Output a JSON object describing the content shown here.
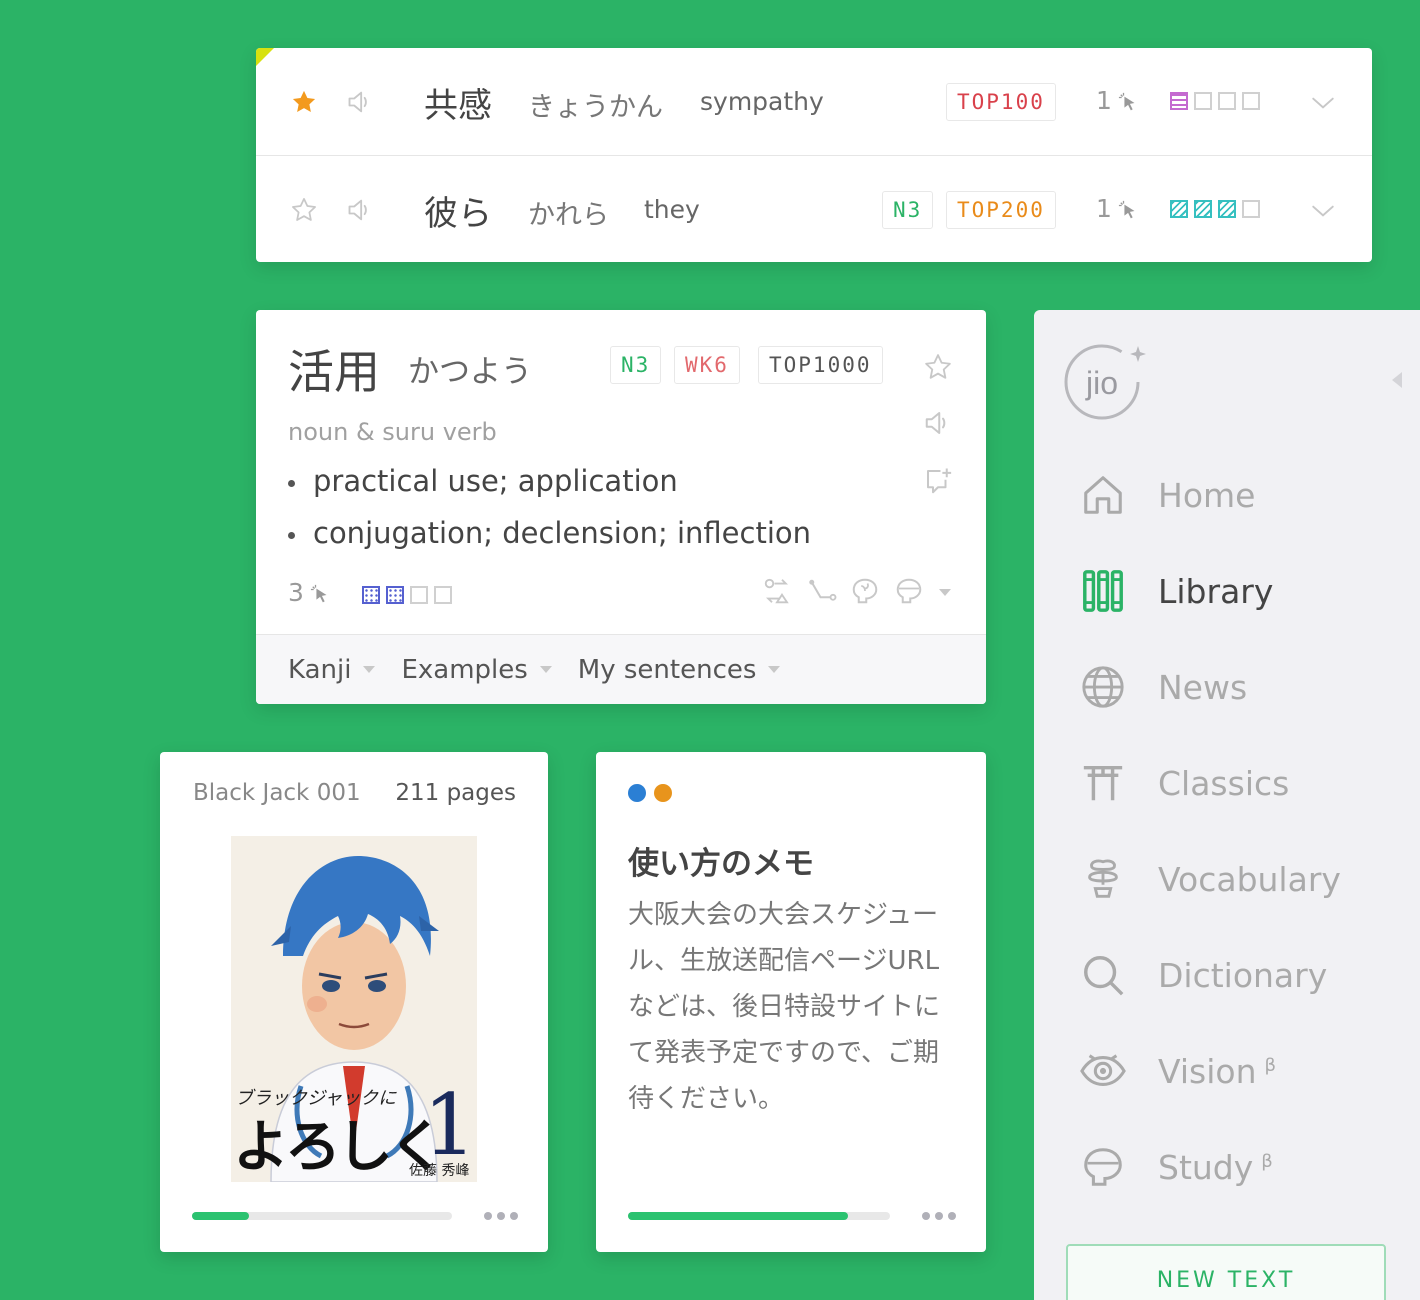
{
  "wordlist": {
    "rows": [
      {
        "starred": true,
        "kanji": "共感",
        "kana": "きょうかん",
        "meaning": "sympathy",
        "tags": [
          "TOP100"
        ],
        "count": "1"
      },
      {
        "starred": false,
        "kanji": "彼ら",
        "kana": "かれら",
        "meaning": "they",
        "tags": [
          "N3",
          "TOP200"
        ],
        "count": "1"
      }
    ]
  },
  "definition": {
    "kanji": "活用",
    "kana": "かつよう",
    "tags": [
      "N3",
      "WK6",
      "TOP1000"
    ],
    "part_of_speech": "noun & suru verb",
    "senses": [
      "practical use; application",
      "conjugation; declension; inflection"
    ],
    "count": "3",
    "footer_tabs": [
      "Kanji",
      "Examples",
      "My sentences"
    ]
  },
  "book": {
    "title": "Black Jack 001",
    "pages": "211 pages",
    "cover_title_small": "ブラックジャックに",
    "cover_title_big": "よろしく",
    "cover_number": "1",
    "cover_author": "佐藤 秀峰",
    "progress": 0.22
  },
  "memo": {
    "title": "使い方のメモ",
    "body": "大阪大会の大会スケジュール、生放送配信ページURLなどは、後日特設サイトにて発表予定ですので、ご期待ください。",
    "dot_colors": [
      "#2b7fd4",
      "#e8941c"
    ],
    "progress": 0.84
  },
  "sidebar": {
    "logo_text": "jio",
    "items": [
      {
        "label": "Home",
        "icon": "home-icon",
        "active": false,
        "beta": ""
      },
      {
        "label": "Library",
        "icon": "library-icon",
        "active": true,
        "beta": ""
      },
      {
        "label": "News",
        "icon": "globe-icon",
        "active": false,
        "beta": ""
      },
      {
        "label": "Classics",
        "icon": "torii-icon",
        "active": false,
        "beta": ""
      },
      {
        "label": "Vocabulary",
        "icon": "bonsai-icon",
        "active": false,
        "beta": ""
      },
      {
        "label": "Dictionary",
        "icon": "search-icon",
        "active": false,
        "beta": ""
      },
      {
        "label": "Vision",
        "icon": "eye-icon",
        "active": false,
        "beta": "β"
      },
      {
        "label": "Study",
        "icon": "head-icon",
        "active": false,
        "beta": "β"
      }
    ],
    "new_text_label": "NEW TEXT"
  },
  "colors": {
    "background": "#2bb366",
    "accent": "#2bb366",
    "star_active": "#f39a1e",
    "tag_red": "#d9414b",
    "tag_orange": "#e98b1a",
    "tag_pink": "#e2696d"
  }
}
